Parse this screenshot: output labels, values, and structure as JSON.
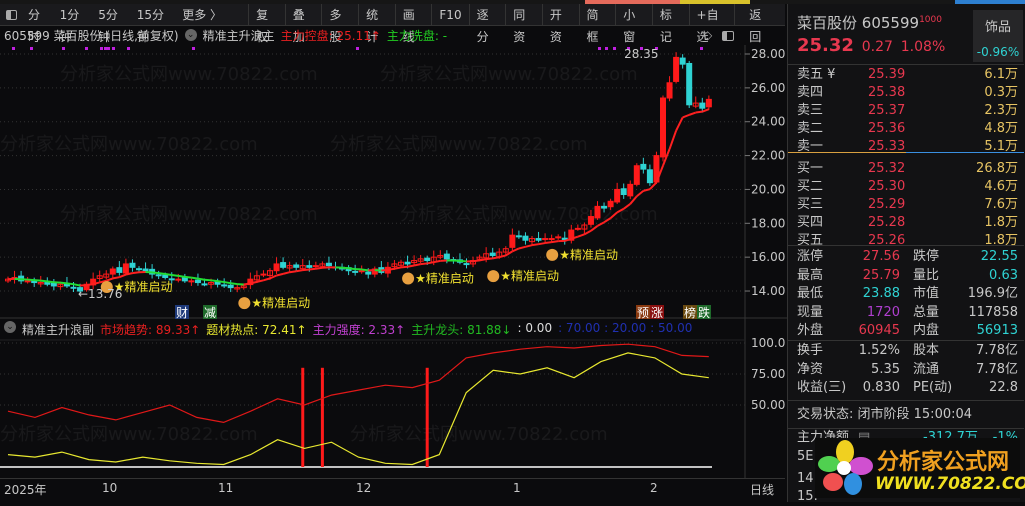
{
  "toolbar": {
    "periods": [
      "分时",
      "1分钟",
      "5分钟",
      "15分钟",
      "更多 〉"
    ],
    "buttons": [
      "复权",
      "叠加",
      "多股",
      "统计",
      "画线",
      "F10",
      "逐分",
      "同资",
      "开资",
      "简框",
      "小窗",
      "标记",
      "+自选",
      "返回"
    ]
  },
  "info": {
    "title": "605599 菜百股份 (日线,前复权)",
    "indicator": "精准主升浪主",
    "control_label": "主力控盘: 25.11↑",
    "wash_label": "主力洗盘: -"
  },
  "sub": {
    "indicator": "精准主升浪副",
    "trend": "市场趋势: 89.33↑",
    "hot": "题材热点: 72.41↑",
    "strength": "主力强度: 2.33↑",
    "dragon": "主升龙头: 81.88↓",
    "zero": ": 0.00",
    "levels": ": 70.00 : 20.00 : 50.00"
  },
  "price_axis": [
    "28.00",
    "26.00",
    "24.00",
    "22.00",
    "20.00",
    "18.00",
    "16.00",
    "14.00"
  ],
  "sub_axis": [
    "100.0",
    "75.00",
    "50.00"
  ],
  "date_axis": {
    "year": "2025年",
    "months": [
      "10",
      "11",
      "12",
      "1",
      "2"
    ],
    "period": "日线"
  },
  "annotations": {
    "start": "★精准启动",
    "high": "28.35",
    "low": "←13.76",
    "cai": "财",
    "jian": "减",
    "yu": "预",
    "zhang": "涨",
    "bang": "榜",
    "die": "跌"
  },
  "watermark": "分析家公式网www.70822.com",
  "quote": {
    "name": "菜百股份",
    "code": "605599",
    "tag": "1000",
    "price": "25.32",
    "change": "0.27",
    "pct": "1.08%",
    "sector": "饰品",
    "sector_pct": "-0.96%"
  },
  "asks": [
    {
      "l": "卖五 ¥",
      "p": "25.39",
      "v": "6.1万"
    },
    {
      "l": "卖四",
      "p": "25.38",
      "v": "0.3万"
    },
    {
      "l": "卖三",
      "p": "25.37",
      "v": "2.3万"
    },
    {
      "l": "卖二",
      "p": "25.36",
      "v": "4.8万"
    },
    {
      "l": "卖一",
      "p": "25.33",
      "v": "5.1万"
    }
  ],
  "bids": [
    {
      "l": "买一",
      "p": "25.32",
      "v": "26.8万"
    },
    {
      "l": "买二",
      "p": "25.30",
      "v": "4.6万"
    },
    {
      "l": "买三",
      "p": "25.29",
      "v": "7.6万"
    },
    {
      "l": "买四",
      "p": "25.28",
      "v": "1.8万"
    },
    {
      "l": "买五",
      "p": "25.26",
      "v": "1.8万"
    }
  ],
  "stats": [
    {
      "l1": "涨停",
      "v1": "27.56",
      "c1": "red",
      "l2": "跌停",
      "v2": "22.55",
      "c2": "cy"
    },
    {
      "l1": "最高",
      "v1": "25.79",
      "c1": "red",
      "l2": "量比",
      "v2": "0.63",
      "c2": "cy"
    },
    {
      "l1": "最低",
      "v1": "23.88",
      "c1": "cy",
      "l2": "市值",
      "v2": "196.9亿",
      "c2": "wh"
    },
    {
      "l1": "现量",
      "v1": "1720",
      "c1": "pur",
      "l2": "总量",
      "v2": "117858",
      "c2": "wh"
    },
    {
      "l1": "外盘",
      "v1": "60945",
      "c1": "red",
      "l2": "内盘",
      "v2": "56913",
      "c2": "cy"
    }
  ],
  "stats2": [
    {
      "l1": "换手",
      "v1": "1.52%",
      "l2": "股本",
      "v2": "7.78亿"
    },
    {
      "l1": "净资",
      "v1": "5.35",
      "l2": "流通",
      "v2": "7.78亿"
    },
    {
      "l1": "收益(三)",
      "v1": "0.830",
      "l2": "PE(动)",
      "v2": "22.8"
    }
  ],
  "status": "交易状态: 闭市阶段 15:00:04",
  "flow": {
    "label": "主力净额",
    "value": "-312.7万",
    "pct": "-1%"
  },
  "partial_rows": [
    "5E",
    "14:",
    "15:"
  ],
  "logo": {
    "name": "分析家公式网",
    "url": "WWW.70822.COM"
  },
  "colors": {
    "up": "#ff1a1a",
    "down": "#2fd3d3",
    "ma_up": "#ff2020",
    "ma_down": "#22dd33",
    "trend": "#e01818",
    "hot": "#e8e830"
  },
  "chart_data": [
    {
      "type": "candlestick",
      "title": "605599 菜百股份 (日线,前复权)",
      "ylim": [
        13,
        29
      ],
      "closes": [
        14.7,
        14.8,
        14.6,
        14.6,
        14.5,
        14.5,
        14.4,
        14.3,
        14.4,
        14.3,
        14.2,
        14.0,
        14.4,
        14.7,
        14.9,
        15.0,
        15.3,
        15.1,
        15.6,
        15.4,
        15.3,
        15.2,
        15.0,
        14.9,
        14.8,
        14.7,
        14.7,
        14.6,
        14.6,
        14.5,
        14.4,
        14.5,
        14.4,
        14.3,
        14.2,
        14.2,
        14.3,
        14.7,
        14.9,
        15.0,
        15.2,
        15.6,
        15.4,
        15.5,
        15.4,
        15.5,
        15.4,
        15.5,
        15.6,
        15.5,
        15.4,
        15.3,
        15.2,
        15.1,
        15.2,
        15.0,
        15.3,
        15.1,
        15.4,
        15.6,
        15.7,
        15.6,
        15.8,
        15.9,
        15.8,
        16.0,
        16.1,
        15.9,
        15.8,
        15.7,
        15.6,
        15.8,
        16.0,
        16.2,
        16.1,
        16.3,
        16.5,
        17.3,
        17.2,
        17.0,
        17.1,
        17.0,
        17.1,
        17.1,
        17.2,
        17.0,
        17.6,
        17.7,
        17.9,
        18.4,
        19.0,
        18.9,
        19.3,
        20.0,
        19.7,
        20.3,
        21.4,
        21.2,
        20.4,
        22.0,
        25.4,
        26.3,
        27.8,
        27.4,
        25.0,
        25.1,
        24.8,
        25.32
      ],
      "high": 28.35,
      "low": 13.76,
      "start_signals": [
        16,
        37,
        62,
        75,
        84
      ]
    },
    {
      "type": "line",
      "title": "精准主升浪副",
      "ylim": [
        0,
        100
      ],
      "series": [
        {
          "name": "市场趋势",
          "values": [
            45,
            40,
            48,
            42,
            38,
            44,
            50,
            40,
            36,
            45,
            55,
            50,
            58,
            62,
            66,
            64,
            70,
            88,
            92,
            95,
            97,
            96,
            98,
            99,
            97,
            90,
            89
          ]
        },
        {
          "name": "题材热点",
          "values": [
            10,
            8,
            12,
            6,
            4,
            8,
            5,
            3,
            2,
            10,
            22,
            15,
            20,
            8,
            3,
            2,
            10,
            60,
            78,
            75,
            80,
            72,
            85,
            92,
            88,
            75,
            72
          ]
        }
      ],
      "columns": [
        45,
        48,
        64
      ]
    }
  ]
}
